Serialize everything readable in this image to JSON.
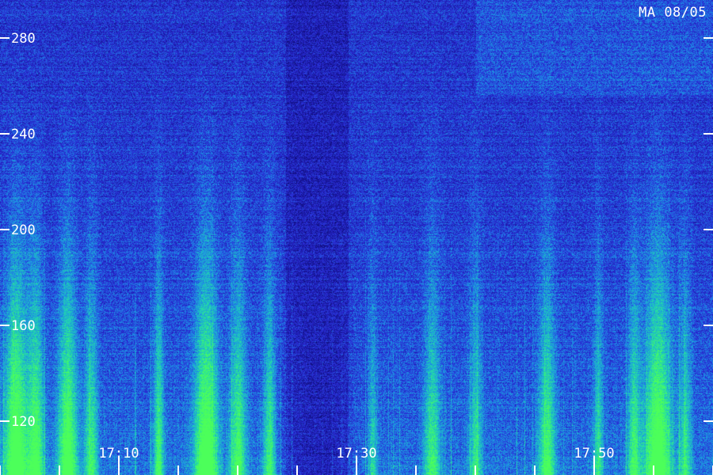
{
  "chart_data": {
    "type": "heatmap",
    "title": "MA 08/05",
    "y_ticks": [
      120,
      160,
      200,
      240,
      280
    ],
    "y_tick_labels": [
      "120",
      "160",
      "200",
      "240",
      "280"
    ],
    "x_tick_labels": [
      "17:10",
      "17:30",
      "17:50"
    ],
    "x_tick_minutes": [
      10,
      30,
      50
    ],
    "x_range_minutes": [
      0,
      60
    ],
    "y_range": [
      100,
      295
    ],
    "minor_tick_interval_minutes": 5,
    "colormap": [
      "#05041c",
      "#12108a",
      "#2a2cd6",
      "#1d8fe6",
      "#20d6b0",
      "#4cff5a"
    ],
    "grid": false
  }
}
